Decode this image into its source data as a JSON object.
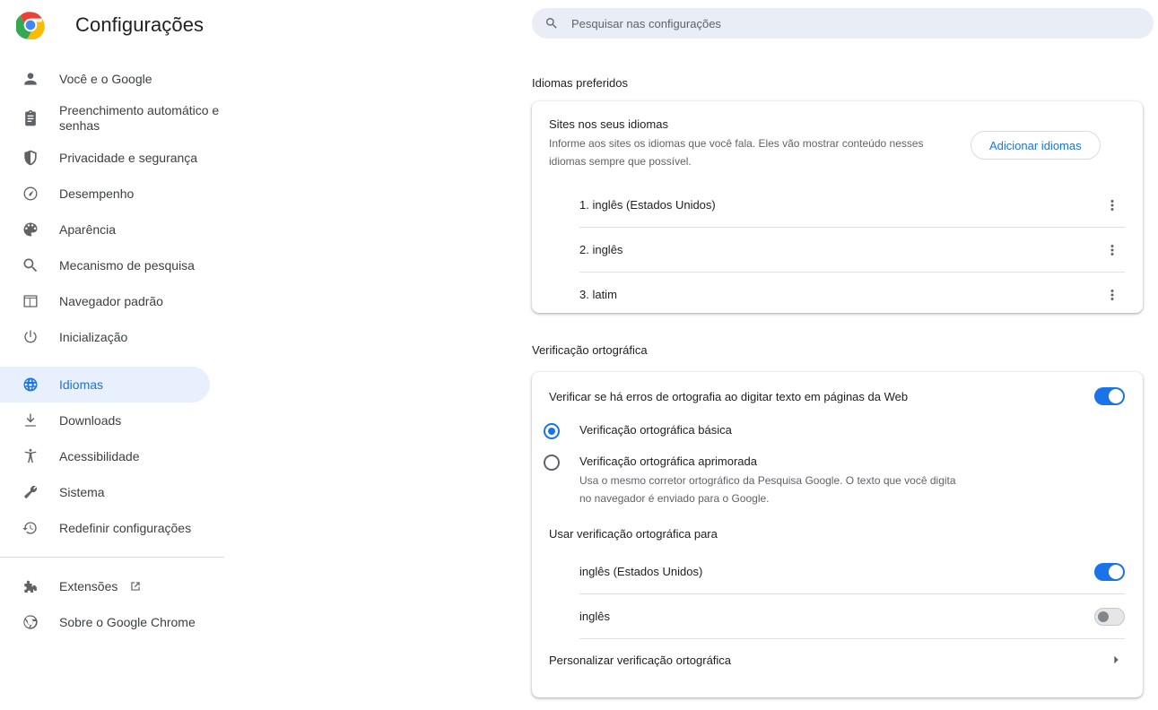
{
  "app": {
    "title": "Configurações",
    "logo_icon": "chrome-logo-icon"
  },
  "search": {
    "placeholder": "Pesquisar nas configurações",
    "value": "",
    "icon": "search-icon"
  },
  "sidebar": {
    "items": [
      {
        "label": "Você e o Google",
        "icon": "person-icon",
        "selected": false
      },
      {
        "label": "Preenchimento automático e senhas",
        "icon": "clipboard-icon",
        "selected": false
      },
      {
        "label": "Privacidade e segurança",
        "icon": "shield-icon",
        "selected": false
      },
      {
        "label": "Desempenho",
        "icon": "speedometer-icon",
        "selected": false
      },
      {
        "label": "Aparência",
        "icon": "palette-icon",
        "selected": false
      },
      {
        "label": "Mecanismo de pesquisa",
        "icon": "search-icon",
        "selected": false
      },
      {
        "label": "Navegador padrão",
        "icon": "browser-window-icon",
        "selected": false
      },
      {
        "label": "Inicialização",
        "icon": "power-icon",
        "selected": false
      },
      {
        "label": "Idiomas",
        "icon": "globe-icon",
        "selected": true
      },
      {
        "label": "Downloads",
        "icon": "download-icon",
        "selected": false
      },
      {
        "label": "Acessibilidade",
        "icon": "accessibility-icon",
        "selected": false
      },
      {
        "label": "Sistema",
        "icon": "wrench-icon",
        "selected": false
      },
      {
        "label": "Redefinir configurações",
        "icon": "history-restore-icon",
        "selected": false
      },
      {
        "label": "Extensões",
        "icon": "puzzle-icon",
        "selected": false,
        "external": true,
        "external_icon": "external-link-icon"
      },
      {
        "label": "Sobre o Google Chrome",
        "icon": "chrome-outline-icon",
        "selected": false
      }
    ]
  },
  "languages_section": {
    "title": "Idiomas preferidos",
    "card": {
      "heading": "Sites nos seus idiomas",
      "description": "Informe aos sites os idiomas que você fala. Eles vão mostrar conteúdo nesses idiomas sempre que possível.",
      "add_button": "Adicionar idiomas",
      "menu_icon": "more-vert-icon",
      "items": [
        {
          "label": "1. inglês (Estados Unidos)"
        },
        {
          "label": "2. inglês"
        },
        {
          "label": "3. latim"
        }
      ]
    }
  },
  "spellcheck_section": {
    "title": "Verificação ortográfica",
    "main_toggle": {
      "label": "Verificar se há erros de ortografia ao digitar texto em páginas da Web",
      "state": "on"
    },
    "options": [
      {
        "label": "Verificação ortográfica básica",
        "description": "",
        "checked": true
      },
      {
        "label": "Verificação ortográfica aprimorada",
        "description": "Usa o mesmo corretor ortográfico da Pesquisa Google. O texto que você digita no navegador é enviado para o Google.",
        "checked": false
      }
    ],
    "use_for_heading": "Usar verificação ortográfica para",
    "language_toggles": [
      {
        "label": "inglês (Estados Unidos)",
        "state": "on"
      },
      {
        "label": "inglês",
        "state": "off"
      }
    ],
    "customize_row": {
      "label": "Personalizar verificação ortográfica",
      "icon": "chevron-right-icon"
    }
  },
  "colors": {
    "accent": "#1a73e8",
    "selected_bg": "#e8f0fe",
    "search_bg": "#e9eef6",
    "text_primary": "#202124",
    "text_secondary": "#5f6368",
    "divider": "#e0e0e0",
    "toggle_off": "#e6e6e6"
  }
}
